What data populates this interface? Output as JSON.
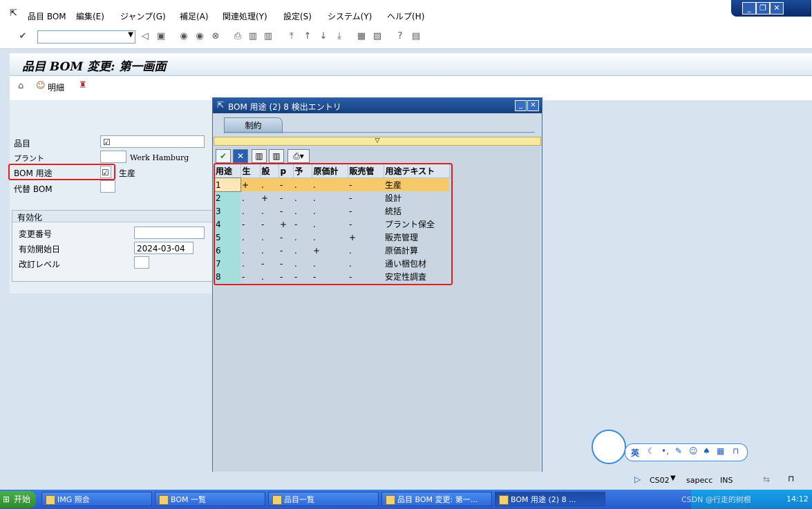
{
  "menu": {
    "items": [
      "品目 BOM",
      "編集(E)",
      "ジャンプ(G)",
      "補足(A)",
      "関連処理(Y)",
      "設定(S)",
      "システム(Y)",
      "ヘルプ(H)"
    ]
  },
  "window_controls": {
    "minimize": "_",
    "restore": "❐",
    "close": "✕"
  },
  "toolbar": {
    "command_value": ""
  },
  "screen": {
    "title": "品目 BOM 変更: 第一画面",
    "detail_button": "明細"
  },
  "form": {
    "material_label": "品目",
    "material_value": "☑",
    "plant_label": "プラント",
    "plant_text": "Werk Hamburg",
    "bom_usage_label": "BOM 用途",
    "bom_usage_value": "☑",
    "bom_usage_text": "生産",
    "alt_bom_label": "代替 BOM",
    "effectivity": {
      "group_title": "有効化",
      "change_number_label": "変更番号",
      "valid_from_label": "有効開始日",
      "valid_from_value": "2024-03-04",
      "revision_label": "改訂レベル"
    }
  },
  "popup": {
    "title": "BOM 用途 (2)   8 検出エントリ",
    "tab_label": "制約",
    "columns": [
      "用途",
      "生",
      "設",
      "p",
      "予",
      "原価計",
      "販売管",
      "用途テキスト"
    ],
    "rows": [
      {
        "cells": [
          "1",
          "+",
          ".",
          "-",
          ".",
          ".",
          "-",
          "生産"
        ],
        "selected": true
      },
      {
        "cells": [
          "2",
          ".",
          "+",
          "-",
          ".",
          ".",
          "-",
          "設計"
        ],
        "selected": false
      },
      {
        "cells": [
          "3",
          ".",
          ".",
          "-",
          ".",
          ".",
          "-",
          "統括"
        ],
        "selected": false
      },
      {
        "cells": [
          "4",
          "-",
          "-",
          "+",
          "-",
          ".",
          "-",
          "プラント保全"
        ],
        "selected": false
      },
      {
        "cells": [
          "5",
          ".",
          ".",
          "-",
          ".",
          ".",
          "+",
          "販売管理"
        ],
        "selected": false
      },
      {
        "cells": [
          "6",
          ".",
          ".",
          "-",
          ".",
          "+",
          ".",
          "原価計算"
        ],
        "selected": false
      },
      {
        "cells": [
          "7",
          ".",
          "-",
          "-",
          ".",
          ".",
          ".",
          "通い梱包材"
        ],
        "selected": false
      },
      {
        "cells": [
          "8",
          "-",
          ".",
          "-",
          "-",
          "-",
          "-",
          "安定性調査"
        ],
        "selected": false
      }
    ]
  },
  "status": {
    "transaction": "CS02",
    "system": "sapecc",
    "mode": "INS"
  },
  "taskbar": {
    "start": "开始",
    "tasks": [
      "IMG 照会",
      "BOM 一覧",
      "品目一覧",
      "品目 BOM 変更: 第一...",
      "BOM 用途 (2)   8 ..."
    ],
    "clock": "14:12",
    "watermark": "CSDN @行走的树根"
  },
  "ime": {
    "lang": "英"
  }
}
